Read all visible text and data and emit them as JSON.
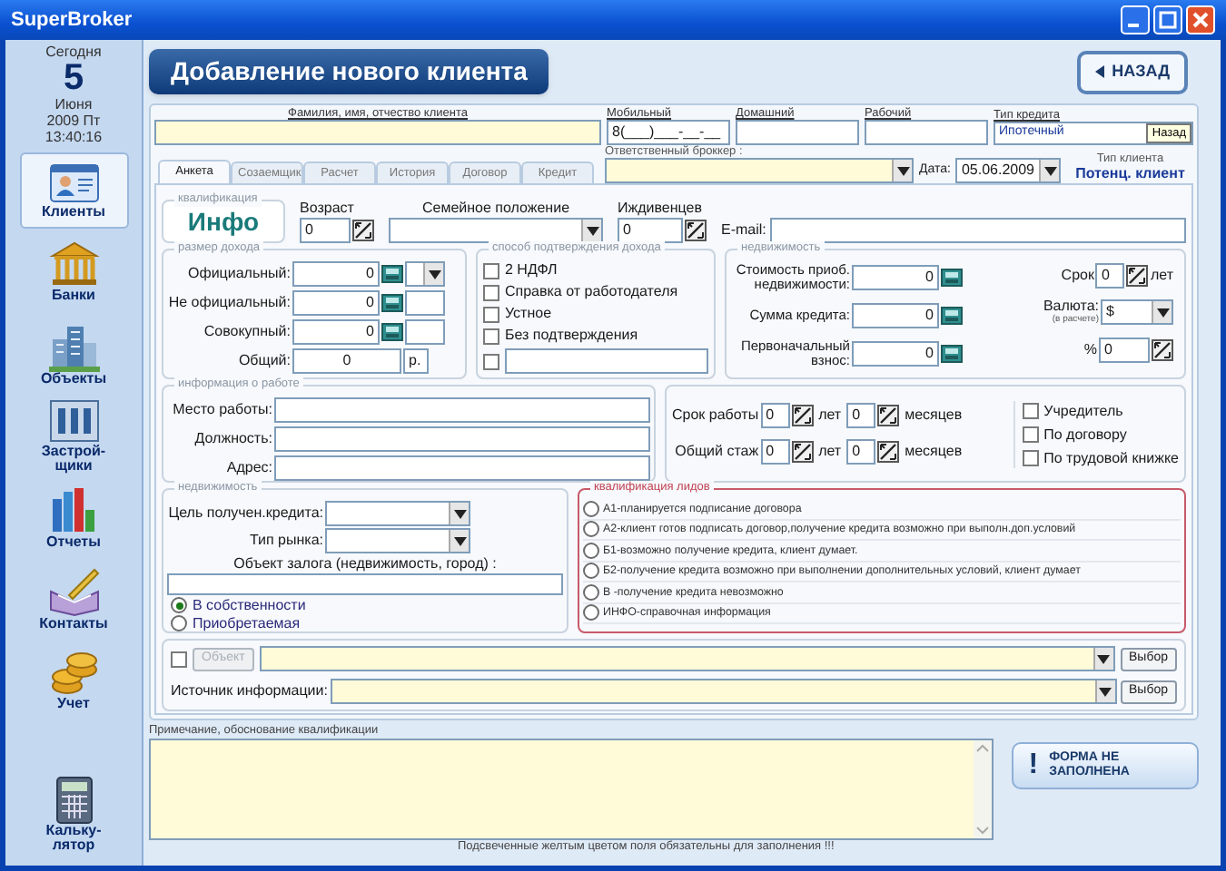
{
  "window": {
    "title": "SuperBroker"
  },
  "sidebar": {
    "date": {
      "label": "Сегодня",
      "day": "5",
      "month": "Июня",
      "year_weekday": "2009 Пт",
      "time": "13:40:16"
    },
    "items": [
      {
        "label": "Клиенты",
        "kind": "clients",
        "selected": true
      },
      {
        "label": "Банки",
        "kind": "banks",
        "selected": false
      },
      {
        "label": "Объекты",
        "kind": "objects",
        "selected": false
      },
      {
        "label": "Застрой-щики",
        "kind": "builders",
        "selected": false
      },
      {
        "label": "Отчеты",
        "kind": "reports",
        "selected": false
      },
      {
        "label": "Контакты",
        "kind": "contacts",
        "selected": false
      },
      {
        "label": "Учет",
        "kind": "accounting",
        "selected": false
      }
    ],
    "calculator": {
      "label": "Кальку-лятор"
    }
  },
  "header": {
    "title": "Добавление нового клиента",
    "back_button": "НАЗАД"
  },
  "client_name": {
    "label": "Фамилия, имя, отчество клиента"
  },
  "phones": [
    {
      "label": "Мобильный",
      "value": "8(___)___-__-__"
    },
    {
      "label": "Домашний"
    },
    {
      "label": "Рабочий"
    }
  ],
  "credit_type": {
    "label": "Тип кредита",
    "value": "Ипотечный",
    "button": "Назад"
  },
  "tabs": [
    {
      "label": "Анкета",
      "selected": true
    },
    {
      "label": "Созаемщик",
      "selected": false
    },
    {
      "label": "Расчет",
      "selected": false
    },
    {
      "label": "История",
      "selected": false
    },
    {
      "label": "Договор",
      "selected": false
    },
    {
      "label": "Кредит",
      "selected": false
    }
  ],
  "broker": {
    "label": "Ответственный броккер :"
  },
  "date": {
    "label": "Дата:",
    "value": "05.06.2009"
  },
  "client_type": {
    "label": "Тип клиента",
    "value": "Потенц. клиент"
  },
  "qualification": {
    "legend": "квалификация",
    "value": "Инфо"
  },
  "age": {
    "label": "Возраст",
    "value": "0"
  },
  "marital": {
    "label": "Семейное положение"
  },
  "dependents": {
    "label": "Иждивенцев",
    "value": "0"
  },
  "email": {
    "label": "E-mail:"
  },
  "income": {
    "legend": "размер дохода",
    "rows": [
      {
        "label": "Официальный:",
        "value": "0",
        "kind": "dropdown"
      },
      {
        "label": "Не официальный:",
        "value": "0",
        "kind": "field"
      },
      {
        "label": "Совокупный:",
        "value": "0",
        "kind": "field"
      }
    ],
    "total": {
      "label": "Общий:",
      "value": "0",
      "unit": "р."
    }
  },
  "income_proof": {
    "legend": "способ подтверждения дохода",
    "options": [
      {
        "label": "2 НДФЛ",
        "checked": false
      },
      {
        "label": "Справка от работодателя",
        "checked": false
      },
      {
        "label": "Устное",
        "checked": false
      },
      {
        "label": "Без подтверждения",
        "checked": false
      }
    ],
    "other": {
      "checked": false
    }
  },
  "property": {
    "legend": "недвижимость",
    "rows": [
      {
        "label": "Стоимость приоб. недвижимости:",
        "value": "0"
      },
      {
        "label": "Сумма кредита:",
        "value": "0"
      },
      {
        "label": "Первоначальный взнос:",
        "value": "0"
      }
    ],
    "term": {
      "label": "Срок",
      "value": "0",
      "unit": "лет"
    },
    "currency": {
      "label": "Валюта:",
      "note": "(в расчете)",
      "value": "$"
    },
    "percent": {
      "label": "%",
      "value": "0"
    }
  },
  "work": {
    "legend": "информация о работе",
    "fields": [
      {
        "label": "Место работы:"
      },
      {
        "label": "Должность:"
      },
      {
        "label": "Адрес:"
      }
    ],
    "durations": [
      {
        "label": "Срок работы",
        "years": "0",
        "years_unit": "лет",
        "months": "0",
        "months_unit": "месяцев"
      },
      {
        "label": "Общий стаж",
        "years": "0",
        "years_unit": "лет",
        "months": "0",
        "months_unit": "месяцев"
      }
    ],
    "flags": [
      {
        "label": "Учредитель",
        "checked": false
      },
      {
        "label": "По договору",
        "checked": false
      },
      {
        "label": "По трудовой книжке",
        "checked": false
      }
    ]
  },
  "realty": {
    "legend": "недвижимость",
    "goal": {
      "label": "Цель получен.кредита:"
    },
    "market": {
      "label": "Тип рынка:"
    },
    "collateral": {
      "label": "Объект залога (недвижимость, город) :"
    },
    "ownership": [
      {
        "label": "В собственности",
        "selected": true
      },
      {
        "label": "Приобретаемая",
        "selected": false
      }
    ]
  },
  "leads": {
    "legend": "квалификация лидов",
    "options": [
      {
        "label": "А1-планируется подписание договора",
        "selected": false
      },
      {
        "label": "А2-клиент готов подписать договор,получение кредита возможно при выполн.доп.условий",
        "selected": false
      },
      {
        "label": "Б1-возможно получение кредита, клиент думает.",
        "selected": false
      },
      {
        "label": "Б2-получение кредита возможно при выполнении дополнительных условий, клиент думает",
        "selected": false
      },
      {
        "label": "В -получение кредита невозможно",
        "selected": false
      },
      {
        "label": "ИНФО-справочная информация",
        "selected": false
      }
    ]
  },
  "object_row": {
    "checked": false,
    "button": "Объект",
    "disabled": true,
    "pick": "Выбор"
  },
  "source": {
    "label": "Источник информации:",
    "pick": "Выбор"
  },
  "notes": {
    "label": "Примечание, обоснование квалификации"
  },
  "status_button": {
    "icon": "!",
    "label": "ФОРМА НЕ ЗАПОЛНЕНА"
  },
  "footer": {
    "note": "Подсвеченные желтым цветом поля обязательны для заполнения !!!"
  }
}
